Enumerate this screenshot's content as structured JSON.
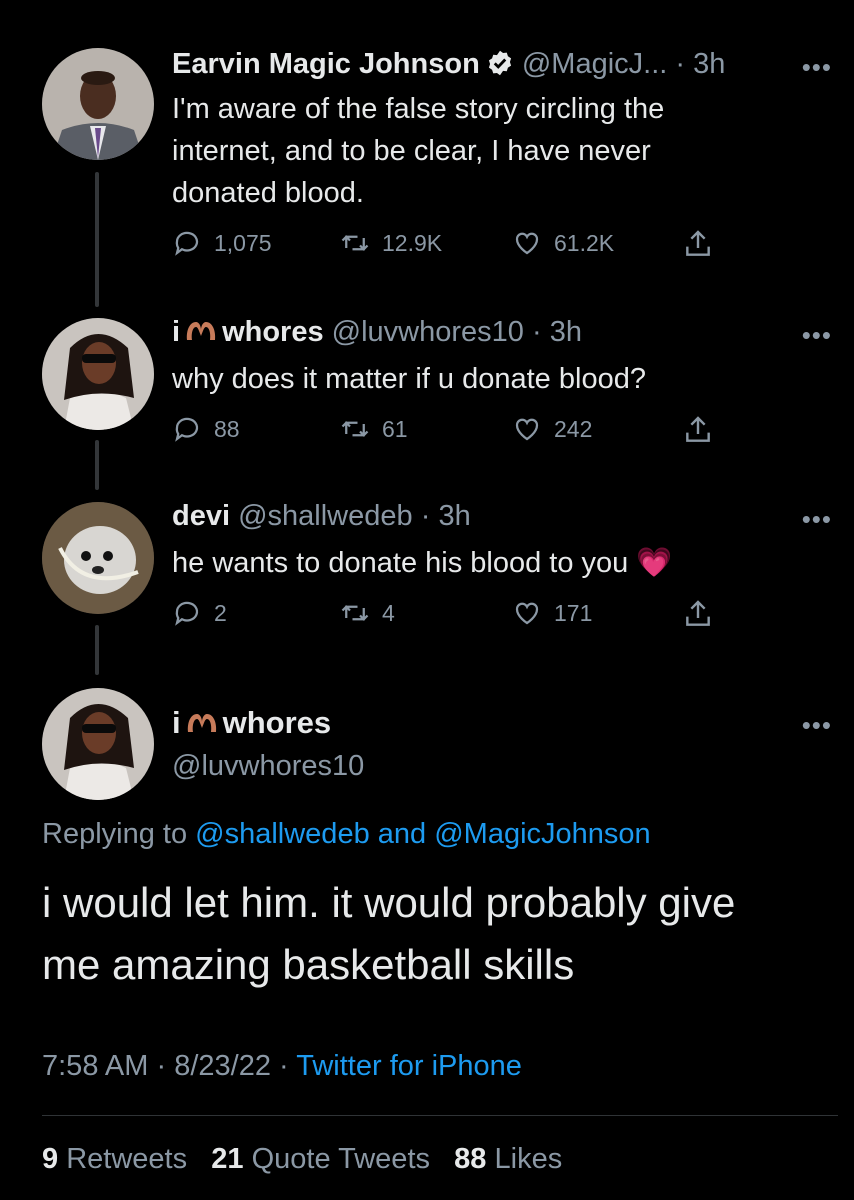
{
  "thread": [
    {
      "name": "Earvin Magic Johnson",
      "handle": "@MagicJ...",
      "time": "3h",
      "verified": true,
      "text_lines": [
        "I'm aware of the false story circling the",
        "internet, and to be clear, I have never",
        "donated blood."
      ],
      "replies": "1,075",
      "retweets": "12.9K",
      "likes": "61.2K"
    },
    {
      "name_prefix": "i",
      "name_suffix": "whores",
      "handle": "@luvwhores10",
      "time": "3h",
      "text_lines": [
        "why does it matter if u donate blood?"
      ],
      "replies": "88",
      "retweets": "61",
      "likes": "242"
    },
    {
      "name": "devi",
      "handle": "@shallwedeb",
      "time": "3h",
      "text_lines": [
        "he wants to donate his blood to you"
      ],
      "emoji": "💗",
      "replies": "2",
      "retweets": "4",
      "likes": "171"
    }
  ],
  "main": {
    "name_prefix": "i",
    "name_suffix": "whores",
    "handle": "@luvwhores10",
    "replying_prefix": "Replying to",
    "replying_to_1": "@shallwedeb",
    "replying_and": "and",
    "replying_to_2": "@MagicJohnson",
    "text_lines": [
      "i would let him. it would probably give",
      "me amazing basketball skills"
    ],
    "time": "7:58 AM",
    "date": "8/23/22",
    "source": "Twitter for iPhone",
    "retweets_count": "9",
    "retweets_label": "Retweets",
    "quotes_count": "21",
    "quotes_label": "Quote Tweets",
    "likes_count": "88",
    "likes_label": "Likes"
  },
  "ui": {
    "more": "•••",
    "dot": "·"
  },
  "colors": {
    "background": "#000000",
    "text": "#e7e9ea",
    "secondary": "#8b98a5",
    "link": "#1d9bf0",
    "thread_line": "#333639"
  }
}
